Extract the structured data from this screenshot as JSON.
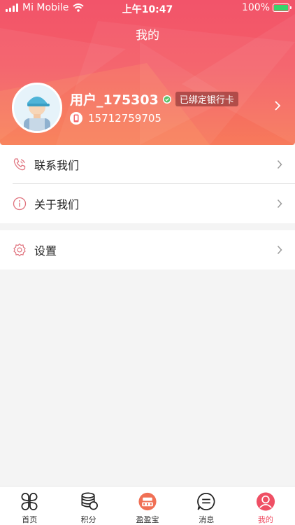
{
  "status_bar": {
    "carrier": "Mi Mobile",
    "time": "上午10:47",
    "battery_percent": "100%",
    "battery_level": 1.0,
    "battery_color": "#36d36b"
  },
  "header": {
    "title": "我的",
    "username": "用户_175303",
    "bank_badge": "已绑定银行卡",
    "phone": "15712759705",
    "gradient_start": "#f2546a",
    "gradient_end": "#f77a5b"
  },
  "menu": {
    "contact_label": "联系我们",
    "contact_icon": "phone-icon",
    "about_label": "关于我们",
    "about_icon": "info-icon",
    "settings_label": "设置",
    "settings_icon": "gear-icon"
  },
  "tabbar": {
    "accent": "#ef4f64",
    "tabs": [
      {
        "label": "首页",
        "icon": "clover-icon"
      },
      {
        "label": "积分",
        "icon": "coin-stack-icon"
      },
      {
        "label": "盈盈宝",
        "icon": "yingyingbao-icon"
      },
      {
        "label": "消息",
        "icon": "message-icon"
      },
      {
        "label": "我的",
        "icon": "user-icon"
      }
    ],
    "active_index": 4
  }
}
